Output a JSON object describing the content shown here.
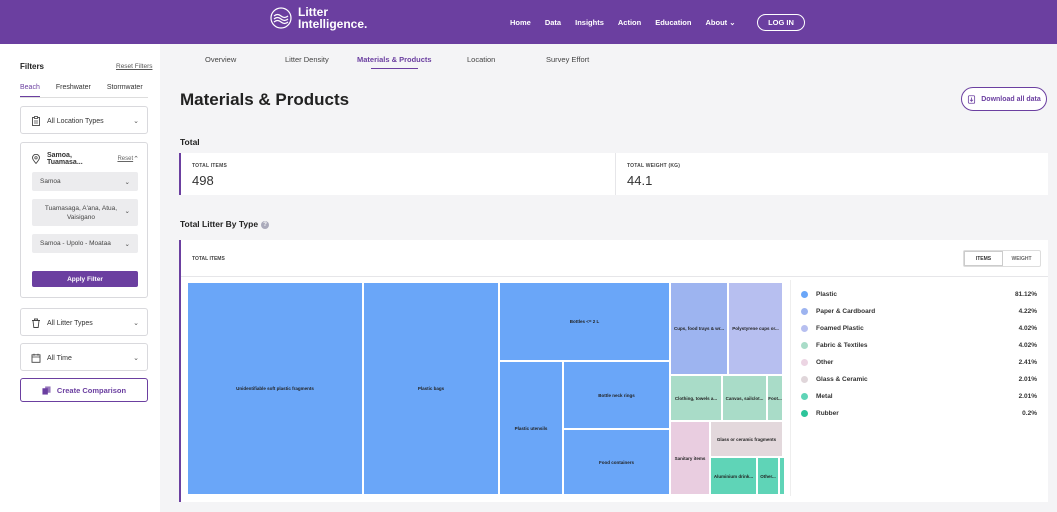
{
  "header": {
    "logo_text": "Litter\nIntelligence.",
    "nav": [
      "Home",
      "Data",
      "Insights",
      "Action",
      "Education",
      "About ⌄"
    ],
    "login": "LOG IN"
  },
  "sidebar": {
    "title": "Filters",
    "reset": "Reset Filters",
    "water_tabs": [
      "Beach",
      "Freshwater",
      "Stormwater"
    ],
    "location_types": "All Location Types",
    "location": {
      "label": "Samoa, Tuamasa...",
      "reset": "Reset",
      "country": "Samoa",
      "region": "Tuamasaga, A'ana, Atua, Vaisigano",
      "site": "Samoa - Upolo - Moataa",
      "apply": "Apply Filter"
    },
    "litter_types": "All Litter Types",
    "time": "All Time",
    "compare": "Create Comparison"
  },
  "subtabs": [
    "Overview",
    "Litter Density",
    "Materials & Products",
    "Location",
    "Survey Effort"
  ],
  "page": {
    "title": "Materials & Products",
    "download": "Download all data",
    "total_title": "Total",
    "total_items_label": "TOTAL ITEMS",
    "total_items": "498",
    "total_weight_label": "TOTAL WEIGHT (KG)",
    "total_weight": "44.1",
    "bytype_title": "Total Litter By Type",
    "panel_label": "TOTAL ITEMS",
    "toggle": [
      "ITEMS",
      "WEIGHT"
    ]
  },
  "treemap": [
    {
      "label": "Unidentifiable soft plastic fragments",
      "color": "#6aa6f8"
    },
    {
      "label": "Plastic bags",
      "color": "#6aa6f8"
    },
    {
      "label": "Bottles <= 2 L",
      "color": "#6aa6f8"
    },
    {
      "label": "Plastic utensils",
      "color": "#6aa6f8"
    },
    {
      "label": "Bottle neck rings",
      "color": "#6aa6f8"
    },
    {
      "label": "Food containers",
      "color": "#6aa6f8"
    },
    {
      "label": "Cups, food trays & wr...",
      "color": "#9db4f0"
    },
    {
      "label": "Polystyrene cups or...",
      "color": "#b7bff0"
    },
    {
      "label": "Clothing, towels a...",
      "color": "#a9dcc8"
    },
    {
      "label": "Canvas, sailclot...",
      "color": "#a9dcc8"
    },
    {
      "label": "Foot...",
      "color": "#a9dcc8"
    },
    {
      "label": "Sanitary items",
      "color": "#e9cde0"
    },
    {
      "label": "Glass or ceramic fragments",
      "color": "#e3d8dc"
    },
    {
      "label": "Aluminium drink...",
      "color": "#5fd4b7"
    },
    {
      "label": "Other...",
      "color": "#5fd4b7"
    },
    {
      "label": "",
      "color": "#5fd4b7"
    }
  ],
  "legend": [
    {
      "name": "Plastic",
      "value": "81.12%",
      "color": "#6aa6f8"
    },
    {
      "name": "Paper & Cardboard",
      "value": "4.22%",
      "color": "#9db4f0"
    },
    {
      "name": "Foamed Plastic",
      "value": "4.02%",
      "color": "#b7bff0"
    },
    {
      "name": "Fabric & Textiles",
      "value": "4.02%",
      "color": "#a9dcc8"
    },
    {
      "name": "Other",
      "value": "2.41%",
      "color": "#ecd5e3"
    },
    {
      "name": "Glass & Ceramic",
      "value": "2.01%",
      "color": "#e0d6da"
    },
    {
      "name": "Metal",
      "value": "2.01%",
      "color": "#5fd4b7"
    },
    {
      "name": "Rubber",
      "value": "0.2%",
      "color": "#2cc49a"
    }
  ]
}
